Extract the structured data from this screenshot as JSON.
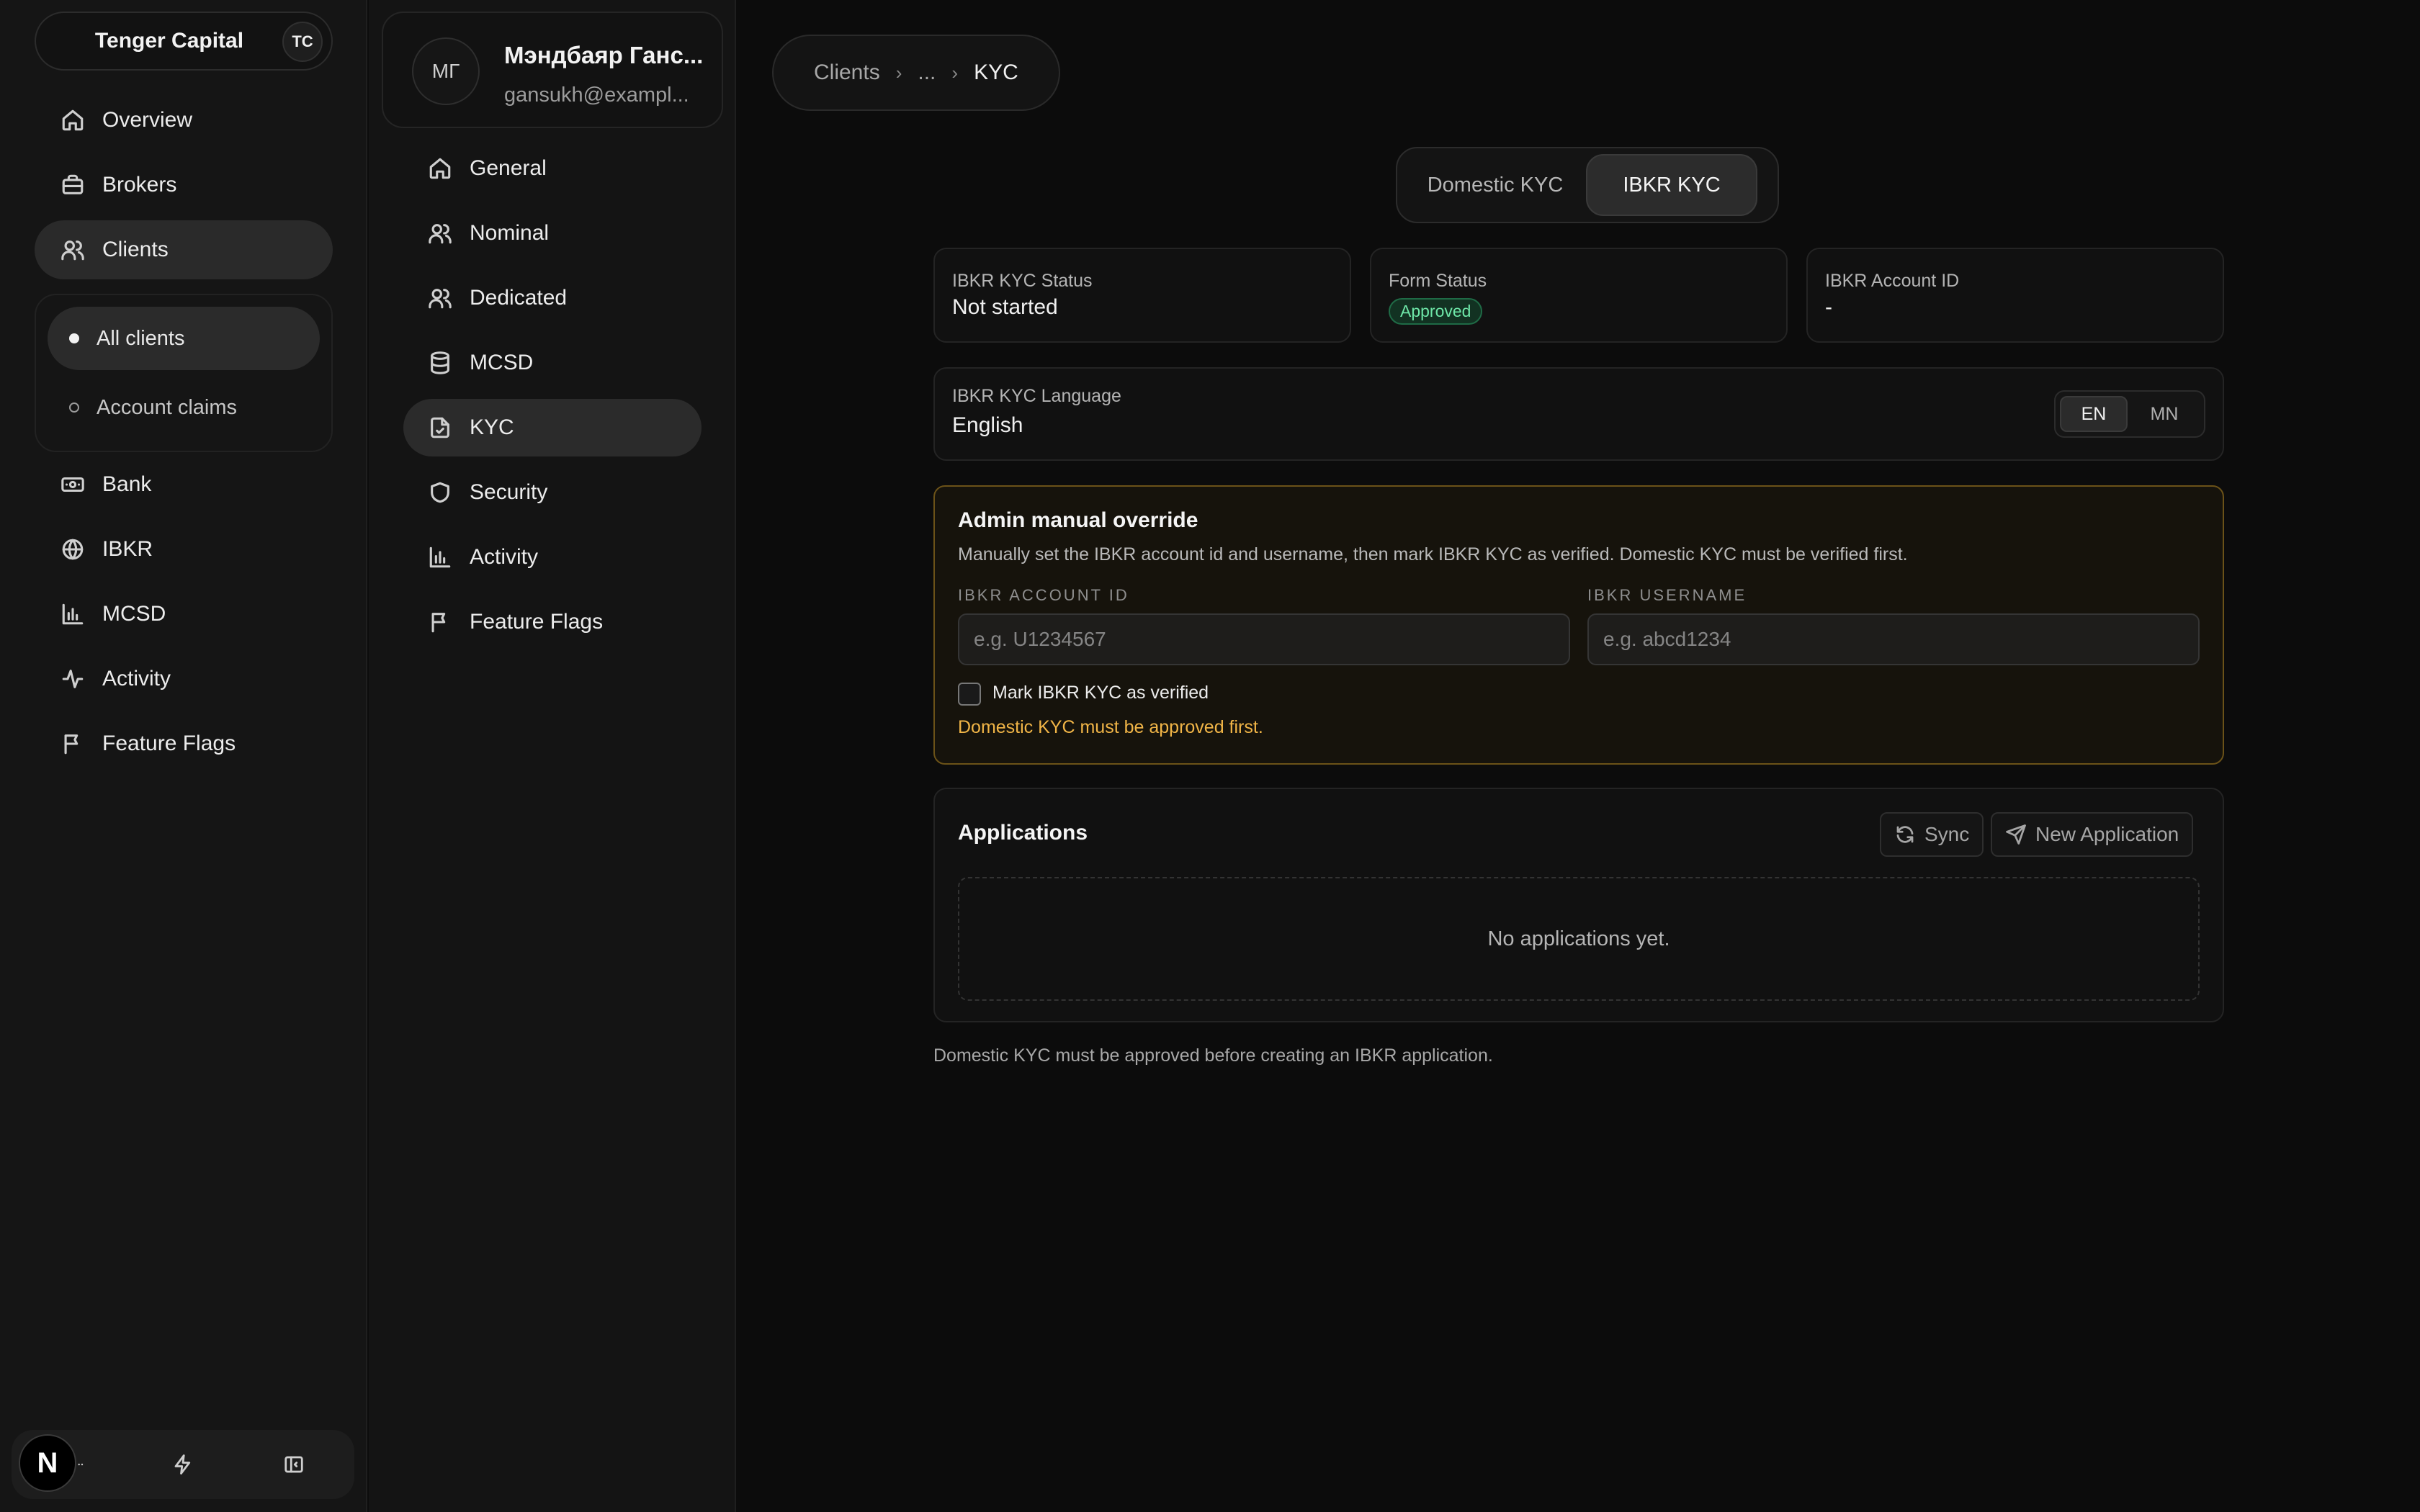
{
  "brand": {
    "name": "Tenger Capital",
    "badge": "TC"
  },
  "nav": {
    "overview": "Overview",
    "brokers": "Brokers",
    "clients": "Clients",
    "clients_sub": {
      "all": "All clients",
      "claims": "Account claims"
    },
    "bank": "Bank",
    "ibkr": "IBKR",
    "mcsd": "MCSD",
    "activity": "Activity",
    "feature_flags": "Feature Flags"
  },
  "footer": {
    "logo": "N"
  },
  "client": {
    "initials": "МГ",
    "name": "Мэндбаяр Ганс...",
    "email": "gansukh@exampl...",
    "menu": {
      "general": "General",
      "nominal": "Nominal",
      "dedicated": "Dedicated",
      "mcsd": "MCSD",
      "kyc": "KYC",
      "security": "Security",
      "activity": "Activity",
      "feature_flags": "Feature Flags"
    }
  },
  "breadcrumb": {
    "root": "Clients",
    "middle": "...",
    "current": "KYC",
    "sep": "›"
  },
  "kyc_tabs": {
    "domestic": "Domestic KYC",
    "ibkr": "IBKR KYC"
  },
  "status_cards": {
    "kyc_status_label": "IBKR KYC Status",
    "kyc_status_value": "Not started",
    "form_status_label": "Form Status",
    "form_status_value": "Approved",
    "account_id_label": "IBKR Account ID",
    "account_id_value": "-"
  },
  "language": {
    "label": "IBKR KYC Language",
    "value": "English",
    "options": [
      "EN",
      "MN"
    ],
    "selected": "EN"
  },
  "override": {
    "title": "Admin manual override",
    "description": "Manually set the IBKR account id and username, then mark IBKR KYC as verified. Domestic KYC must be verified first.",
    "account_id_label": "IBKR ACCOUNT ID",
    "account_id_placeholder": "e.g. U1234567",
    "account_id_value": "",
    "username_label": "IBKR USERNAME",
    "username_placeholder": "e.g. abcd1234",
    "username_value": "",
    "checkbox_label": "Mark IBKR KYC as verified",
    "checkbox_checked": false,
    "warning": "Domestic KYC must be approved first."
  },
  "applications": {
    "title": "Applications",
    "sync_label": "Sync",
    "new_label": "New Application",
    "empty": "No applications yet."
  },
  "footnote": "Domestic KYC must be approved before creating an IBKR application.",
  "colors": {
    "background": "#0c0c0c",
    "approved": "#6ee7a8",
    "warning": "#f1b547",
    "override_border": "#6b5218"
  }
}
